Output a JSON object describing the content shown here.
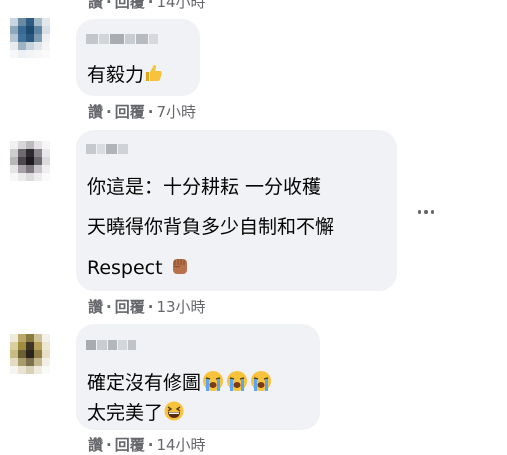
{
  "comments": [
    {
      "lines": [],
      "actions": {
        "like": "讚",
        "reply": "回覆",
        "time": "14小時",
        "separator": "·"
      }
    },
    {
      "lines": [
        "有毅力"
      ],
      "emoji": [
        "thumbs-up"
      ],
      "actions": {
        "like": "讚",
        "reply": "回覆",
        "time": "7小時",
        "separator": "·"
      }
    },
    {
      "lines": [
        "你這是：十分耕耘 一分收穫",
        "天曉得你背負多少自制和不懈",
        "Respect"
      ],
      "emoji": [
        "raised-fist"
      ],
      "actions": {
        "like": "讚",
        "reply": "回覆",
        "time": "13小時",
        "separator": "·"
      }
    },
    {
      "lines": [
        "確定沒有修圖",
        "太完美了"
      ],
      "emoji": [
        "loudly-crying-face",
        "loudly-crying-face",
        "loudly-crying-face",
        "grinning-squinting-face"
      ],
      "actions": {
        "like": "讚",
        "reply": "回覆",
        "time": "14小時",
        "separator": "·"
      }
    }
  ],
  "colors": {
    "bubble": "#f0f2f5",
    "meta": "#65676b",
    "text": "#050505"
  }
}
